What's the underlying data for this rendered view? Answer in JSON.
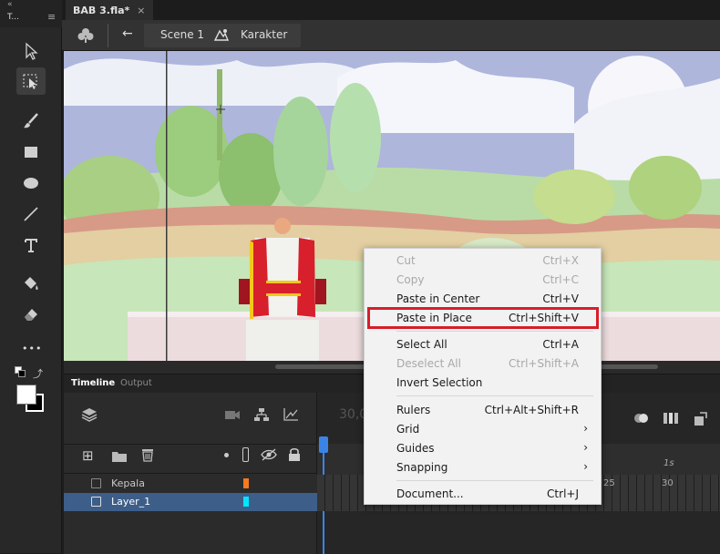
{
  "toolbar": {
    "collapse_label": "«",
    "title": "T...",
    "menu_icon": "≡",
    "tools": [
      "selection-tool",
      "subselection-tool",
      "brush-tool",
      "rectangle-tool",
      "oval-tool",
      "line-tool",
      "text-tool",
      "paint-bucket-tool",
      "eraser-tool",
      "more-tools",
      "swap-colors",
      "stroke-fill"
    ],
    "more_label": "•••"
  },
  "tab": {
    "title": "BAB 3.fla*",
    "close": "×"
  },
  "breadcrumb": {
    "scene": "Scene 1",
    "symbol": "Karakter",
    "back_arrow": "←"
  },
  "timeline": {
    "tabs": [
      "Timeline",
      "Output"
    ],
    "fps": "30,0",
    "layers": [
      {
        "name": "Kepala",
        "color": "#f47a20"
      },
      {
        "name": "Layer_1",
        "color": "#00e5ff"
      }
    ],
    "frame_numbers": [
      "25",
      "30"
    ],
    "seconds_marker": "1s"
  },
  "context_menu": {
    "items": [
      {
        "label": "Cut",
        "shortcut": "Ctrl+X",
        "enabled": false
      },
      {
        "label": "Copy",
        "shortcut": "Ctrl+C",
        "enabled": false
      },
      {
        "label": "Paste in Center",
        "shortcut": "Ctrl+V",
        "enabled": true
      },
      {
        "label": "Paste in Place",
        "shortcut": "Ctrl+Shift+V",
        "enabled": true,
        "highlighted": true
      },
      {
        "label": "Select All",
        "shortcut": "Ctrl+A",
        "enabled": true
      },
      {
        "label": "Deselect All",
        "shortcut": "Ctrl+Shift+A",
        "enabled": false
      },
      {
        "label": "Invert Selection",
        "shortcut": "",
        "enabled": true
      },
      {
        "label": "Rulers",
        "shortcut": "Ctrl+Alt+Shift+R",
        "enabled": true
      },
      {
        "label": "Grid",
        "submenu": true
      },
      {
        "label": "Guides",
        "submenu": true
      },
      {
        "label": "Snapping",
        "submenu": true
      },
      {
        "label": "Document...",
        "shortcut": "Ctrl+J",
        "enabled": true
      }
    ],
    "highlight_color": "#d81d2a"
  }
}
